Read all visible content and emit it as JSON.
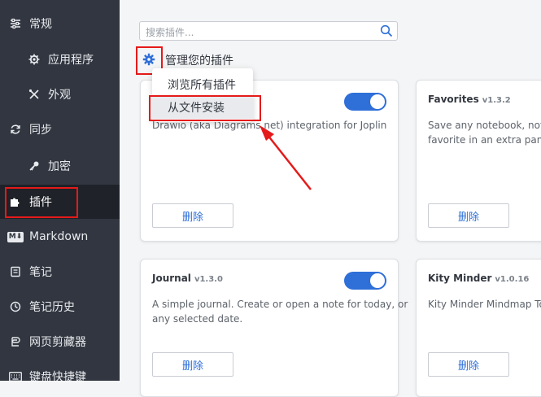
{
  "sidebar": {
    "items": [
      {
        "label": "常规",
        "icon": "sliders-icon"
      },
      {
        "label": "应用程序",
        "icon": "gear-icon"
      },
      {
        "label": "外观",
        "icon": "tools-icon"
      },
      {
        "label": "同步",
        "icon": "sync-icon"
      },
      {
        "label": "加密",
        "icon": "key-icon"
      },
      {
        "label": "插件",
        "icon": "puzzle-icon"
      },
      {
        "label": "Markdown",
        "icon": "markdown-icon",
        "icon_text": "M⬇"
      },
      {
        "label": "笔记",
        "icon": "note-icon"
      },
      {
        "label": "笔记历史",
        "icon": "history-icon"
      },
      {
        "label": "网页剪藏器",
        "icon": "clipper-icon"
      },
      {
        "label": "键盘快捷键",
        "icon": "keyboard-icon"
      }
    ],
    "active": "插件"
  },
  "search": {
    "placeholder": "搜索插件..."
  },
  "manage": {
    "title": "管理您的插件"
  },
  "menu": {
    "items": [
      "浏览所有插件",
      "从文件安装"
    ],
    "hovered": "从文件安装"
  },
  "plugins": [
    {
      "name": "",
      "version": "",
      "description": "Drawio (aka Diagrams.net) integration for Joplin",
      "enabled": true,
      "delete_label": "删除"
    },
    {
      "name": "Favorites",
      "version": "v1.3.2",
      "description": "Save any notebook, note, t",
      "description2": "favorite in an extra panel v",
      "delete_label": "删除"
    },
    {
      "name": "Journal",
      "version": "v1.3.0",
      "description": "A simple journal. Create or open a note for today, or",
      "description2": "any selected date.",
      "enabled": true,
      "delete_label": "删除"
    },
    {
      "name": "Kity Minder",
      "version": "v1.0.16",
      "description": "Kity Minder Mindmap Tool",
      "delete_label": "删除"
    }
  ],
  "colors": {
    "sidebar_bg": "#313640",
    "sidebar_active_bg": "#1f2228",
    "accent": "#2e6fd8",
    "annotation_red": "#e51a1a"
  }
}
